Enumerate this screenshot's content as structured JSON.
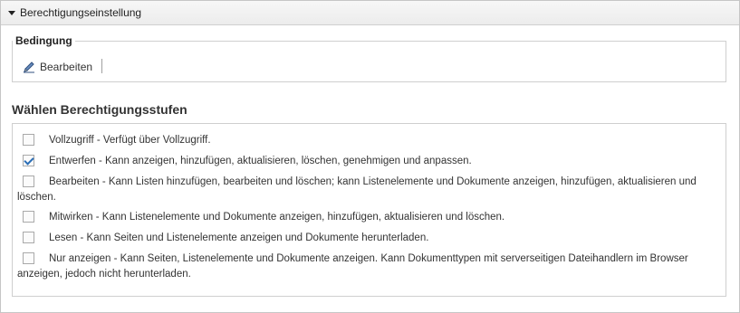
{
  "section": {
    "title": "Berechtigungseinstellung"
  },
  "condition": {
    "legend": "Bedingung",
    "edit_label": "Bearbeiten"
  },
  "permissions": {
    "title": "Wählen Berechtigungsstufen",
    "options": [
      {
        "label": "Vollzugriff - Verfügt über Vollzugriff.",
        "checked": false
      },
      {
        "label": "Entwerfen - Kann anzeigen, hinzufügen, aktualisieren, löschen, genehmigen und anpassen.",
        "checked": true
      },
      {
        "label": "Bearbeiten - Kann Listen hinzufügen, bearbeiten und löschen; kann Listenelemente und Dokumente anzeigen, hinzufügen, aktualisieren und löschen.",
        "checked": false
      },
      {
        "label": "Mitwirken - Kann Listenelemente und Dokumente anzeigen, hinzufügen, aktualisieren und löschen.",
        "checked": false
      },
      {
        "label": "Lesen - Kann Seiten und Listenelemente anzeigen und Dokumente herunterladen.",
        "checked": false
      },
      {
        "label": "Nur anzeigen - Kann Seiten, Listenelemente und Dokumente anzeigen. Kann Dokumenttypen mit serverseitigen Dateihandlern im Browser anzeigen, jedoch nicht herunterladen.",
        "checked": false
      }
    ]
  },
  "colors": {
    "check_mark": "#2a6db5",
    "border": "#cfcfcf"
  }
}
